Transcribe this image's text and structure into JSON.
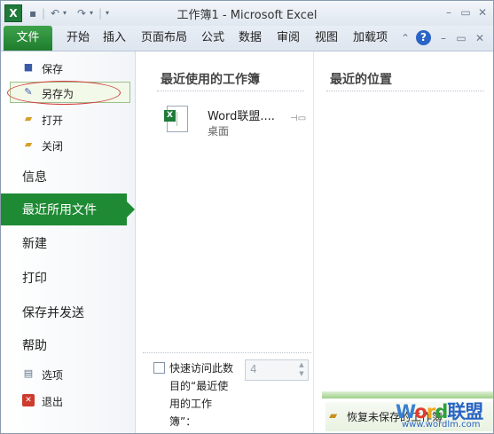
{
  "titlebar": {
    "app_title": "工作簿1 - Microsoft Excel",
    "logo_letter": "X"
  },
  "tabs": {
    "file": "文件",
    "items": [
      "开始",
      "插入",
      "页面布局",
      "公式",
      "数据",
      "审阅",
      "视图",
      "加载项"
    ]
  },
  "backstage": {
    "top_items": [
      {
        "label": "保存",
        "icon": "save-icon"
      },
      {
        "label": "另存为",
        "icon": "save-as-icon"
      },
      {
        "label": "打开",
        "icon": "open-folder-icon"
      },
      {
        "label": "关闭",
        "icon": "close-folder-icon"
      }
    ],
    "info": "信息",
    "recent": "最近所用文件",
    "new": "新建",
    "print": "打印",
    "save_send": "保存并发送",
    "help": "帮助",
    "options": "选项",
    "exit": "退出"
  },
  "recent_workbooks": {
    "title": "最近使用的工作簿",
    "items": [
      {
        "name": "Word联盟....",
        "location": "桌面"
      }
    ]
  },
  "recent_places": {
    "title": "最近的位置"
  },
  "quick_access": {
    "label": "快速访问此数目的“最近使用的工作簿”：",
    "value": "4",
    "checked": false
  },
  "restore": {
    "label": "恢复未保存的工作簿"
  },
  "watermark": {
    "brand_parts": [
      "W",
      "o",
      "r",
      "d",
      "联盟"
    ],
    "url": "www.wordlm.com"
  },
  "colors": {
    "accent": "#1f8a34",
    "file_tab": "#2a8f3a",
    "highlight": "#d23a3a"
  }
}
